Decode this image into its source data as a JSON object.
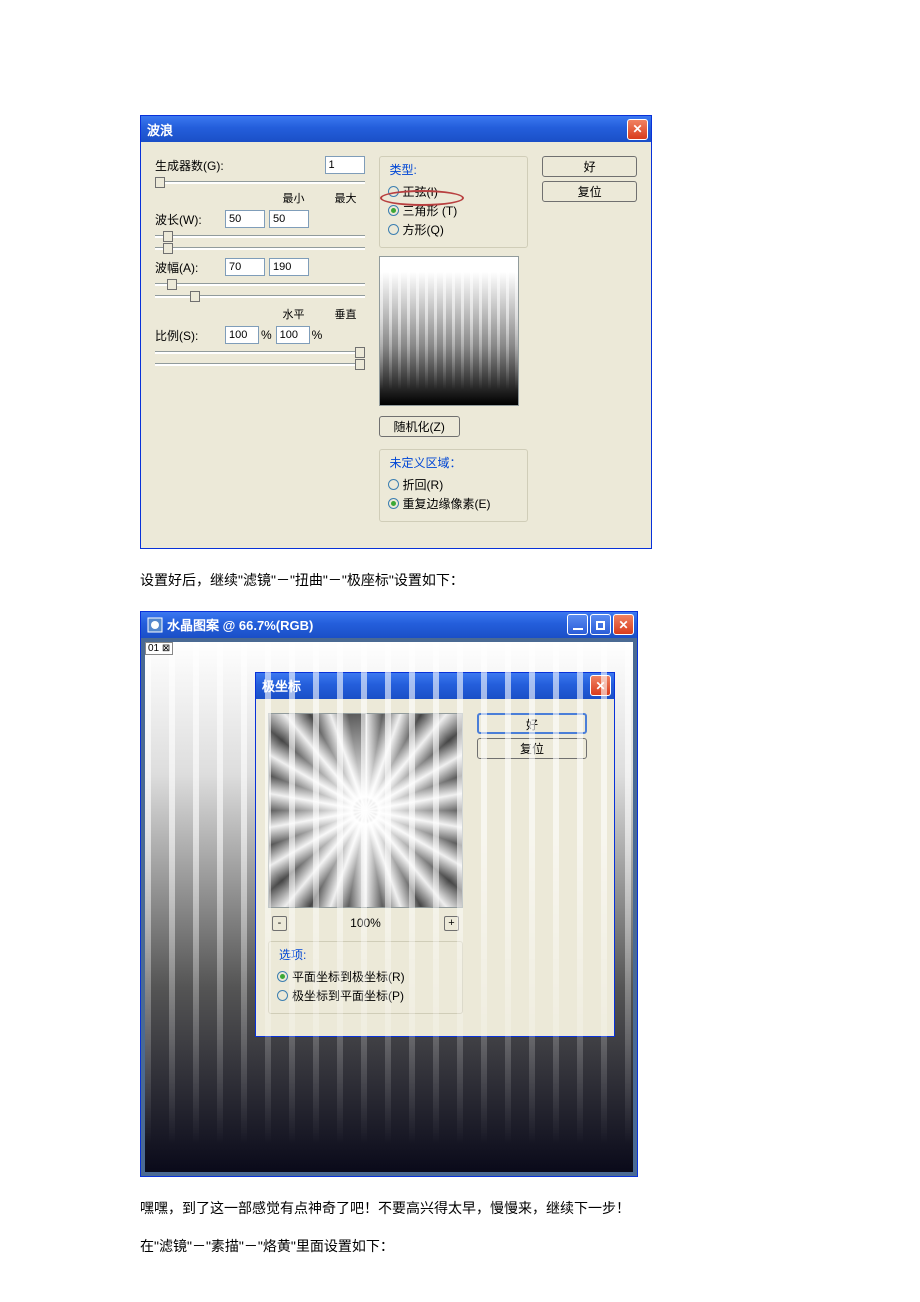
{
  "wave": {
    "title": "波浪",
    "generators_label": "生成器数(G):",
    "generators_value": "1",
    "min_label": "最小",
    "max_label": "最大",
    "wavelength_label": "波长(W):",
    "wavelength_min": "50",
    "wavelength_max": "50",
    "amplitude_label": "波幅(A):",
    "amplitude_min": "70",
    "amplitude_max": "190",
    "horiz_label": "水平",
    "vert_label": "垂直",
    "scale_label": "比例(S):",
    "scale_h": "100",
    "scale_v": "100",
    "pct": "%",
    "type_legend": "类型:",
    "type_sine": "正弦(I)",
    "type_triangle": "三角形  (T)",
    "type_square": "方形(Q)",
    "randomize": "随机化(Z)",
    "undef_legend": "未定义区域：",
    "undef_wrap": "折回(R)",
    "undef_repeat": "重复边缘像素(E)",
    "ok": "好",
    "reset": "复位"
  },
  "para1": "设置好后，继续\"滤镜\"－\"扭曲\"－\"极座标\"设置如下：",
  "doc": {
    "title": "水晶图案 @ 66.7%(RGB)",
    "tab": "01"
  },
  "polar": {
    "title": "极坐标",
    "ok": "好",
    "reset": "复位",
    "zoom": "100%",
    "opts_legend": "选项:",
    "opt_rect2polar": "平面坐标到极坐标(R)",
    "opt_polar2rect": "极坐标到平面坐标(P)"
  },
  "para2": "嘿嘿，到了这一部感觉有点神奇了吧！不要高兴得太早，慢慢来，继续下一步！",
  "para3": "在\"滤镜\"－\"素描\"－\"烙黄\"里面设置如下："
}
